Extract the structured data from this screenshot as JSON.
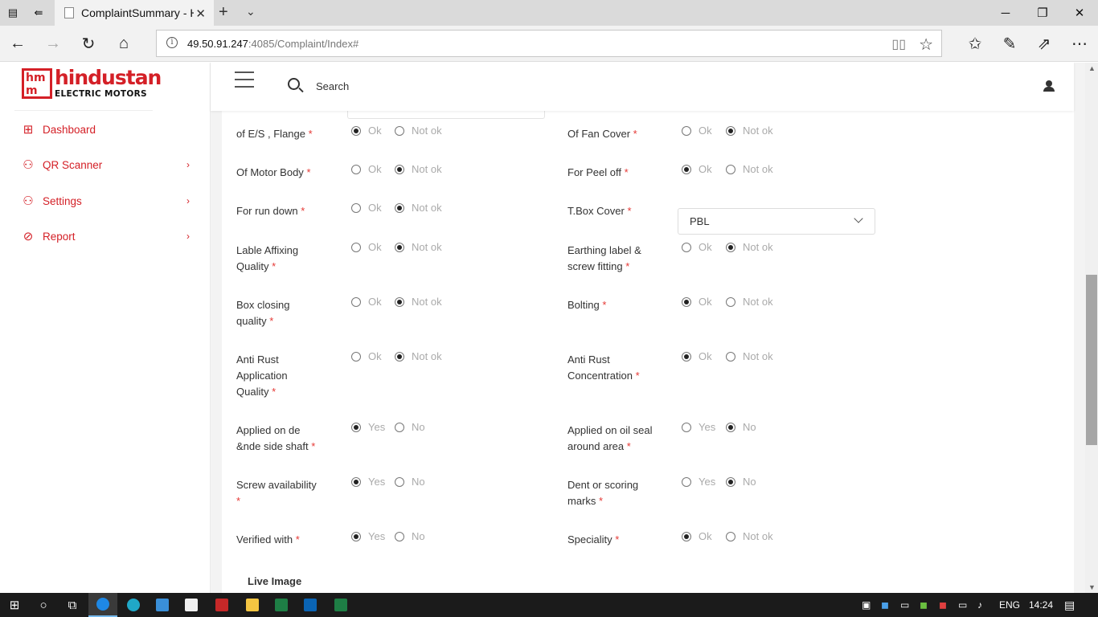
{
  "browser": {
    "tab_title": "ComplaintSummary - H",
    "url_host": "49.50.91.247",
    "url_path": ":4085/Complaint/Index#"
  },
  "logo": {
    "mark_top": "hm",
    "mark_bottom": "m",
    "brand": "hindustan",
    "tagline": "ELECTRIC MOTORS"
  },
  "sidebar": {
    "items": [
      {
        "label": "Dashboard",
        "icon": "dashboard-grid-icon",
        "has_submenu": false
      },
      {
        "label": "QR Scanner",
        "icon": "users-icon",
        "has_submenu": true
      },
      {
        "label": "Settings",
        "icon": "users-icon",
        "has_submenu": true
      },
      {
        "label": "Report",
        "icon": "paperclip-icon",
        "has_submenu": true
      }
    ]
  },
  "topbar": {
    "search_label": "Search"
  },
  "form": {
    "left": [
      {
        "label": "of E/S , Flange",
        "options": [
          "Ok",
          "Not ok"
        ],
        "selected": "Ok"
      },
      {
        "label": "Of Motor Body",
        "options": [
          "Ok",
          "Not ok"
        ],
        "selected": "Not ok"
      },
      {
        "label": "For run down",
        "options": [
          "Ok",
          "Not ok"
        ],
        "selected": "Not ok"
      },
      {
        "label_lines": [
          "Lable Affixing",
          "Quality"
        ],
        "options": [
          "Ok",
          "Not ok"
        ],
        "selected": "Not ok"
      },
      {
        "label_lines": [
          "Box closing",
          "quality"
        ],
        "options": [
          "Ok",
          "Not ok"
        ],
        "selected": "Not ok"
      },
      {
        "label_lines": [
          "Anti Rust",
          "Application",
          "Quality"
        ],
        "options": [
          "Ok",
          "Not ok"
        ],
        "selected": "Not ok"
      },
      {
        "label_lines": [
          "Applied on de",
          "&nde side shaft"
        ],
        "options": [
          "Yes",
          "No"
        ],
        "selected": "Yes"
      },
      {
        "label_lines": [
          "Screw availability",
          ""
        ],
        "options": [
          "Yes",
          "No"
        ],
        "selected": "Yes"
      },
      {
        "label": "Verified with",
        "options": [
          "Yes",
          "No"
        ],
        "selected": "Yes"
      }
    ],
    "right": [
      {
        "label": "Of Fan Cover",
        "options": [
          "Ok",
          "Not ok"
        ],
        "selected": "Not ok"
      },
      {
        "label": "For Peel off",
        "options": [
          "Ok",
          "Not ok"
        ],
        "selected": "Ok"
      },
      {
        "label": "T.Box Cover",
        "select_value": "PBL"
      },
      {
        "label_lines": [
          "Earthing label &",
          "screw fitting"
        ],
        "options": [
          "Ok",
          "Not ok"
        ],
        "selected": "Not ok"
      },
      {
        "label": "Bolting",
        "options": [
          "Ok",
          "Not ok"
        ],
        "selected": "Ok"
      },
      {
        "label_lines": [
          "Anti Rust",
          "Concentration"
        ],
        "options": [
          "Ok",
          "Not ok"
        ],
        "selected": "Ok"
      },
      {
        "label_lines": [
          "Applied on oil seal",
          "around area"
        ],
        "options": [
          "Yes",
          "No"
        ],
        "selected": "No"
      },
      {
        "label_lines": [
          "Dent or scoring",
          "marks"
        ],
        "options": [
          "Yes",
          "No"
        ],
        "selected": "No"
      },
      {
        "label": "Speciality",
        "options": [
          "Ok",
          "Not ok"
        ],
        "selected": "Ok"
      }
    ],
    "required_mark": "*",
    "section_title": "Live Image"
  },
  "taskbar": {
    "lang": "ENG",
    "time": "14:24"
  },
  "colors": {
    "brand_red": "#d42027",
    "required_red": "#e53935"
  }
}
